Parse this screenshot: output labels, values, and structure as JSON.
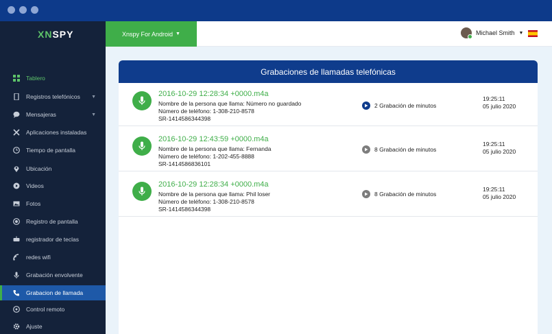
{
  "brand": {
    "logo_x": "XN",
    "logo_rest": "SPY"
  },
  "topbar": {
    "product_label": "Xnspy For Android",
    "user_name": "Michael Smith"
  },
  "sidebar": {
    "items": [
      {
        "label": "Tablero",
        "icon": "dashboard-icon"
      },
      {
        "label": "Registros telefónicos",
        "icon": "phone-icon"
      },
      {
        "label": "Mensajeras",
        "icon": "chat-icon"
      },
      {
        "label": "Aplicaciones instaladas",
        "icon": "tools-icon"
      },
      {
        "label": "Tiempo de pantalla",
        "icon": "clock-icon"
      },
      {
        "label": "Ubicación",
        "icon": "location-icon"
      },
      {
        "label": "Videos",
        "icon": "video-icon"
      },
      {
        "label": "Fotos",
        "icon": "photo-icon"
      },
      {
        "label": "Registro de pantalla",
        "icon": "screen-record-icon"
      },
      {
        "label": "registrador de teclas",
        "icon": "keylogger-icon"
      },
      {
        "label": "redes wifi",
        "icon": "wifi-icon"
      },
      {
        "label": "Grabación envolvente",
        "icon": "microphone-icon"
      },
      {
        "label": "Grabacion de llamada",
        "icon": "call-record-icon"
      },
      {
        "label": "Control remoto",
        "icon": "remote-icon"
      },
      {
        "label": "Ajuste",
        "icon": "gear-icon"
      }
    ]
  },
  "panel": {
    "title": "Grabaciones de llamadas telefónicas",
    "recordings": [
      {
        "file": "2016-10-29 12:28:34 +0000.m4a",
        "caller_line": "Nombre de la persona que llama:   Número no guardado",
        "phone_line": "Número de teléfono:  1-308-210-8578",
        "serial": "SR-1414586344398",
        "recording": "2 Grabación de minutos",
        "time": "19:25:11",
        "date": "05 julio 2020"
      },
      {
        "file": "2016-10-29 12:43:59 +0000.m4a",
        "caller_line": "Nombre de la persona que llama:   Fernanda",
        "phone_line": "Número de teléfono:  1-202-455-8888",
        "serial": "SR-1414586836101",
        "recording": "8 Grabación de minutos",
        "time": "19:25:11",
        "date": "05 julio 2020"
      },
      {
        "file": "2016-10-29 12:28:34 +0000.m4a",
        "caller_line": "Nombre de la persona que llama:    Phil loser",
        "phone_line": "Número de teléfono:    1-308-210-8578",
        "serial": "SR-1414586344398",
        "recording": "8 Grabación de minutos",
        "time": "19:25:11",
        "date": "05 julio 2020"
      }
    ]
  },
  "colors": {
    "accent_green": "#3fae49",
    "navy": "#0f3c8c",
    "sidebar_bg": "#14223a",
    "titlebar": "#0d3a8a"
  }
}
